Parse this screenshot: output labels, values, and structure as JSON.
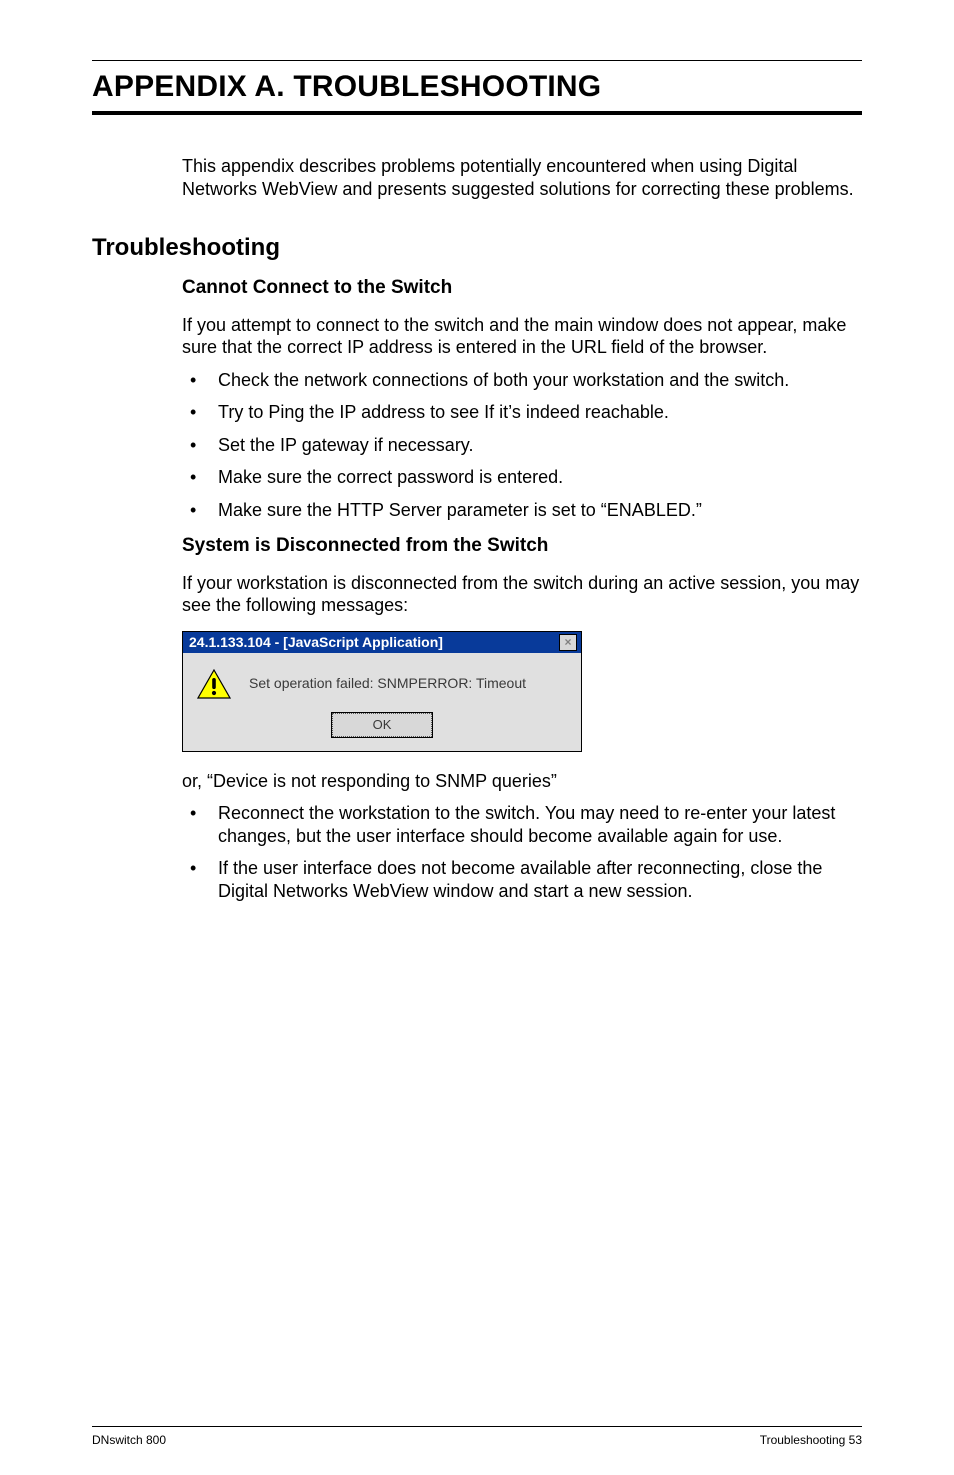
{
  "appendix_title": "APPENDIX A.  TROUBLESHOOTING",
  "intro": "This appendix describes problems potentially encountered when using Digital Networks WebView and presents suggested solutions for correcting these problems.",
  "section_heading": "Troubleshooting",
  "sub1_heading": "Cannot Connect to the Switch",
  "sub1_para": "If you attempt to connect to the switch and the main window does not appear, make sure that the correct IP address is entered in the URL field of the browser.",
  "sub1_bullets": [
    "Check the network connections of both your workstation and the switch.",
    "Try to Ping the IP address to see If it’s indeed reachable.",
    "Set the IP gateway if necessary.",
    "Make sure the correct password is entered.",
    "Make sure the HTTP Server parameter is set to “ENABLED.”"
  ],
  "sub2_heading": "System is Disconnected from the Switch",
  "sub2_para": "If your workstation is disconnected from the switch during an active session, you may see the following messages:",
  "dialog": {
    "title": "24.1.133.104 - [JavaScript Application]",
    "message": "Set operation failed: SNMPERROR: Timeout",
    "ok_label": "OK",
    "close_label": "×"
  },
  "post_dialog_para": "or, “Device is not responding to SNMP queries”",
  "sub2_bullets": [
    "Reconnect the workstation to the switch. You may need to re-enter your latest changes, but the user interface should become available again for use.",
    "If the user interface does not become available after reconnecting, close the Digital Networks WebView window and start a new session."
  ],
  "footer": {
    "left": "DNswitch 800",
    "right": "Troubleshooting  53"
  }
}
